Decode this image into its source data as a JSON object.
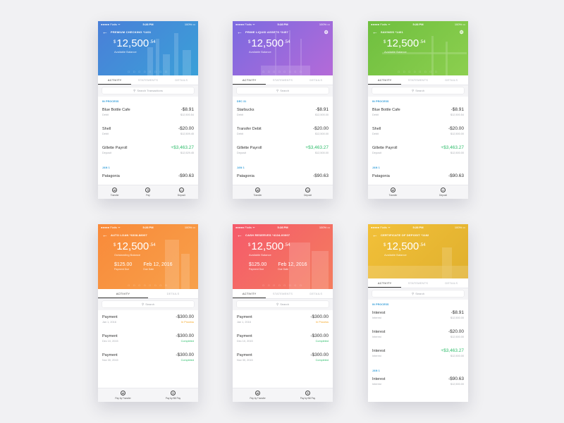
{
  "status": {
    "carrier": "●●●●● Fiatts  ᯤ",
    "time": "5:28 PM",
    "battery": "100% ▭"
  },
  "hero_deco": "☐ ☐ ☐ ☐ ☐ ☐ ☐ ☐",
  "colors": {
    "checking": [
      "#4a7fd8",
      "#3aa0d8"
    ],
    "liquid": [
      "#7b6ae0",
      "#b46ad8"
    ],
    "savings": [
      "#6fbf3f",
      "#8ccf4f"
    ],
    "loan": [
      "#f98a3a",
      "#f7a04a"
    ],
    "reserves": [
      "#f55a6b",
      "#f47d5e"
    ],
    "cd": [
      "#f2c039",
      "#e0b02e"
    ],
    "section": "#2a98d6",
    "positive": "#2ebd6b",
    "processing": "#f5a623"
  },
  "screens": [
    {
      "account_title": "PREMIUM CHECKING *1401",
      "currency": "$",
      "balance_whole": "12,500",
      "balance_cents": ".54",
      "balance_label": "Available Balance",
      "tabs": [
        "ACTIVITY",
        "STATEMENTS",
        "DETAILS"
      ],
      "search_placeholder": "Search Transactions",
      "sections": [
        {
          "label": "IN PROCESS",
          "items": [
            {
              "name": "Blue Bottle Cafe",
              "amount": "-$8.91",
              "type": "Debit",
              "balance": "$12,500.54"
            },
            {
              "name": "Shell",
              "amount": "-$20.00",
              "type": "Debit",
              "balance": "$12,509.45"
            },
            {
              "name": "Gillette Payroll",
              "amount": "+$3,463.27",
              "type": "Deposit",
              "balance": "$12,529.45"
            }
          ]
        },
        {
          "label": "JAN 1",
          "items": [
            {
              "name": "Patagonia",
              "amount": "-$90.63",
              "type": "",
              "balance": ""
            }
          ]
        }
      ],
      "footer": [
        {
          "icon": "⇄",
          "label": "Transfer"
        },
        {
          "icon": "$",
          "label": "Pay"
        },
        {
          "icon": "▭",
          "label": "Deposit"
        }
      ]
    },
    {
      "account_title": "PRIME LIQUID ASSETS *3457",
      "currency": "$",
      "balance_whole": "12,500",
      "balance_cents": ".54",
      "balance_label": "Available Balance",
      "tabs": [
        "ACTIVITY",
        "STATEMENTS",
        "DETAILS"
      ],
      "search_placeholder": "Search",
      "sections": [
        {
          "label": "DEC 31",
          "items": [
            {
              "name": "Starbucks",
              "amount": "-$8.91",
              "type": "Debit",
              "balance": "$12,500.00"
            },
            {
              "name": "Transfer Debit",
              "amount": "-$20.00",
              "type": "Debit",
              "balance": "$12,500.00"
            },
            {
              "name": "Gillette Payroll",
              "amount": "+$3,463.27",
              "type": "Deposit",
              "balance": "$12,500.00"
            }
          ]
        },
        {
          "label": "JAN 1",
          "items": [
            {
              "name": "Patagonia",
              "amount": "-$90.63",
              "type": "",
              "balance": ""
            }
          ]
        }
      ],
      "footer": [
        {
          "icon": "⇄",
          "label": "Transfer"
        },
        {
          "icon": "▭",
          "label": "Deposit"
        }
      ]
    },
    {
      "account_title": "SAVINGS *1401",
      "currency": "$",
      "balance_whole": "12,500",
      "balance_cents": ".54",
      "balance_label": "Available Balance",
      "tabs": [
        "ACTIVITY",
        "STATEMENTS",
        "DETAILS"
      ],
      "search_placeholder": "Search",
      "sections": [
        {
          "label": "IN PROCESS",
          "items": [
            {
              "name": "Blue Bottle Cafe",
              "amount": "-$8.91",
              "type": "Debit",
              "balance": "$12,500.54"
            },
            {
              "name": "Shell",
              "amount": "-$20.00",
              "type": "Debit",
              "balance": "$12,500.00"
            },
            {
              "name": "Gillette Payroll",
              "amount": "+$3,463.27",
              "type": "Deposit",
              "balance": "$12,500.00"
            }
          ]
        },
        {
          "label": "JAN 1",
          "items": [
            {
              "name": "Patagonia",
              "amount": "-$90.63",
              "type": "",
              "balance": ""
            }
          ]
        }
      ],
      "footer": [
        {
          "icon": "⇄",
          "label": "Transfer"
        },
        {
          "icon": "▭",
          "label": "Deposit"
        }
      ]
    },
    {
      "account_title": "AUTO LOAN *6338-88007",
      "currency": "$",
      "balance_whole": "12,500",
      "balance_cents": ".54",
      "balance_label": "Outstanding Balance",
      "payment_due_value": "$125.00",
      "payment_due_label": "Payment Due",
      "due_date_value": "Feb 12, 2016",
      "due_date_label": "Due Date",
      "tabs": [
        "ACTIVITY",
        "DETAILS"
      ],
      "search_placeholder": "Search",
      "payments": [
        {
          "name": "Payment",
          "amount": "-$300.00",
          "date": "Jan 1, 2016",
          "status": "In Process",
          "state": "proc"
        },
        {
          "name": "Payment",
          "amount": "-$300.00",
          "date": "Dec 10, 2015",
          "status": "Completed",
          "state": "done"
        },
        {
          "name": "Payment",
          "amount": "-$300.00",
          "date": "Nov 30, 2015",
          "status": "Completed",
          "state": "done"
        }
      ],
      "footer": [
        {
          "icon": "⇄",
          "label": "Pay by Transfer"
        },
        {
          "icon": "$",
          "label": "Pay by Bill Pay"
        }
      ]
    },
    {
      "account_title": "CASH RESERVES *4134-00007",
      "currency": "$",
      "balance_whole": "12,500",
      "balance_cents": ".54",
      "balance_label": "Available Balance",
      "payment_due_value": "$125.00",
      "payment_due_label": "Payment Due",
      "due_date_value": "Feb 12, 2016",
      "due_date_label": "Due Date",
      "tabs": [
        "ACTIVITY",
        "STATEMENTS",
        "DETAILS"
      ],
      "search_placeholder": "Search",
      "payments": [
        {
          "name": "Payment",
          "amount": "-$300.00",
          "date": "Jan 1, 2016",
          "status": "In Process",
          "state": "proc"
        },
        {
          "name": "Payment",
          "amount": "-$300.00",
          "date": "Dec 10, 2015",
          "status": "Completed",
          "state": "done"
        },
        {
          "name": "Payment",
          "amount": "-$300.00",
          "date": "Nov 30, 2015",
          "status": "Completed",
          "state": "done"
        }
      ],
      "footer": [
        {
          "icon": "⇄",
          "label": "Pay by Transfer"
        },
        {
          "icon": "$",
          "label": "Pay by Bill Pay"
        }
      ]
    },
    {
      "account_title": "CERTIFICATE OF DEPOSIT *1182",
      "currency": "$",
      "balance_whole": "12,500",
      "balance_cents": ".54",
      "balance_label": "Available Balance",
      "tabs": [
        "ACTIVITY",
        "STATEMENTS",
        "DETAILS"
      ],
      "search_placeholder": "Search",
      "sections": [
        {
          "label": "IN PROCESS",
          "items": [
            {
              "name": "Interest",
              "amount": "-$8.91",
              "type": "Interest",
              "balance": "$12,500.00"
            },
            {
              "name": "Interest",
              "amount": "-$20.00",
              "type": "Interest",
              "balance": "$12,500.00"
            },
            {
              "name": "Interest",
              "amount": "+$3,463.27",
              "type": "Interest",
              "balance": "$12,500.00"
            }
          ]
        },
        {
          "label": "JAN 1",
          "items": [
            {
              "name": "Interest",
              "amount": "-$90.63",
              "type": "Interest",
              "balance": "$12,500.00"
            }
          ]
        }
      ]
    }
  ]
}
